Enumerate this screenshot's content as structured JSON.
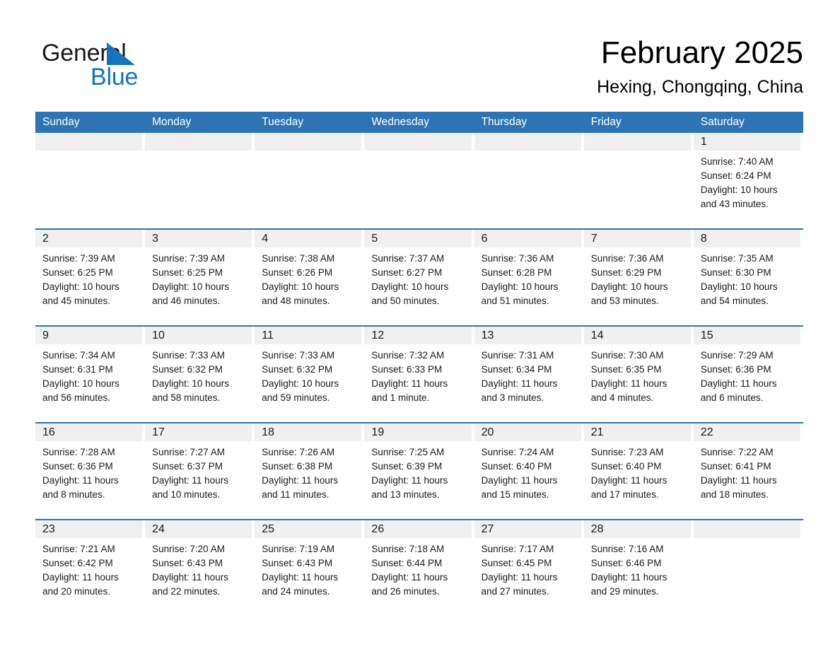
{
  "brand": {
    "logo_line1": "General",
    "logo_line2": "Blue",
    "accent_color": "#1573bd"
  },
  "header": {
    "month_title": "February 2025",
    "location": "Hexing, Chongqing, China",
    "header_bar_color": "#2e74b5",
    "date_band_color": "#f0f0f0"
  },
  "weekdays": [
    {
      "label": "Sunday"
    },
    {
      "label": "Monday"
    },
    {
      "label": "Tuesday"
    },
    {
      "label": "Wednesday"
    },
    {
      "label": "Thursday"
    },
    {
      "label": "Friday"
    },
    {
      "label": "Saturday"
    }
  ],
  "weeks": [
    {
      "days": [
        {
          "number": "",
          "empty": true,
          "sunrise": "",
          "sunset": "",
          "daylight_line1": "",
          "daylight_line2": ""
        },
        {
          "number": "",
          "empty": true,
          "sunrise": "",
          "sunset": "",
          "daylight_line1": "",
          "daylight_line2": ""
        },
        {
          "number": "",
          "empty": true,
          "sunrise": "",
          "sunset": "",
          "daylight_line1": "",
          "daylight_line2": ""
        },
        {
          "number": "",
          "empty": true,
          "sunrise": "",
          "sunset": "",
          "daylight_line1": "",
          "daylight_line2": ""
        },
        {
          "number": "",
          "empty": true,
          "sunrise": "",
          "sunset": "",
          "daylight_line1": "",
          "daylight_line2": ""
        },
        {
          "number": "",
          "empty": true,
          "sunrise": "",
          "sunset": "",
          "daylight_line1": "",
          "daylight_line2": ""
        },
        {
          "number": "1",
          "empty": false,
          "sunrise": "Sunrise: 7:40 AM",
          "sunset": "Sunset: 6:24 PM",
          "daylight_line1": "Daylight: 10 hours",
          "daylight_line2": "and 43 minutes."
        }
      ]
    },
    {
      "days": [
        {
          "number": "2",
          "empty": false,
          "sunrise": "Sunrise: 7:39 AM",
          "sunset": "Sunset: 6:25 PM",
          "daylight_line1": "Daylight: 10 hours",
          "daylight_line2": "and 45 minutes."
        },
        {
          "number": "3",
          "empty": false,
          "sunrise": "Sunrise: 7:39 AM",
          "sunset": "Sunset: 6:25 PM",
          "daylight_line1": "Daylight: 10 hours",
          "daylight_line2": "and 46 minutes."
        },
        {
          "number": "4",
          "empty": false,
          "sunrise": "Sunrise: 7:38 AM",
          "sunset": "Sunset: 6:26 PM",
          "daylight_line1": "Daylight: 10 hours",
          "daylight_line2": "and 48 minutes."
        },
        {
          "number": "5",
          "empty": false,
          "sunrise": "Sunrise: 7:37 AM",
          "sunset": "Sunset: 6:27 PM",
          "daylight_line1": "Daylight: 10 hours",
          "daylight_line2": "and 50 minutes."
        },
        {
          "number": "6",
          "empty": false,
          "sunrise": "Sunrise: 7:36 AM",
          "sunset": "Sunset: 6:28 PM",
          "daylight_line1": "Daylight: 10 hours",
          "daylight_line2": "and 51 minutes."
        },
        {
          "number": "7",
          "empty": false,
          "sunrise": "Sunrise: 7:36 AM",
          "sunset": "Sunset: 6:29 PM",
          "daylight_line1": "Daylight: 10 hours",
          "daylight_line2": "and 53 minutes."
        },
        {
          "number": "8",
          "empty": false,
          "sunrise": "Sunrise: 7:35 AM",
          "sunset": "Sunset: 6:30 PM",
          "daylight_line1": "Daylight: 10 hours",
          "daylight_line2": "and 54 minutes."
        }
      ]
    },
    {
      "days": [
        {
          "number": "9",
          "empty": false,
          "sunrise": "Sunrise: 7:34 AM",
          "sunset": "Sunset: 6:31 PM",
          "daylight_line1": "Daylight: 10 hours",
          "daylight_line2": "and 56 minutes."
        },
        {
          "number": "10",
          "empty": false,
          "sunrise": "Sunrise: 7:33 AM",
          "sunset": "Sunset: 6:32 PM",
          "daylight_line1": "Daylight: 10 hours",
          "daylight_line2": "and 58 minutes."
        },
        {
          "number": "11",
          "empty": false,
          "sunrise": "Sunrise: 7:33 AM",
          "sunset": "Sunset: 6:32 PM",
          "daylight_line1": "Daylight: 10 hours",
          "daylight_line2": "and 59 minutes."
        },
        {
          "number": "12",
          "empty": false,
          "sunrise": "Sunrise: 7:32 AM",
          "sunset": "Sunset: 6:33 PM",
          "daylight_line1": "Daylight: 11 hours",
          "daylight_line2": "and 1 minute."
        },
        {
          "number": "13",
          "empty": false,
          "sunrise": "Sunrise: 7:31 AM",
          "sunset": "Sunset: 6:34 PM",
          "daylight_line1": "Daylight: 11 hours",
          "daylight_line2": "and 3 minutes."
        },
        {
          "number": "14",
          "empty": false,
          "sunrise": "Sunrise: 7:30 AM",
          "sunset": "Sunset: 6:35 PM",
          "daylight_line1": "Daylight: 11 hours",
          "daylight_line2": "and 4 minutes."
        },
        {
          "number": "15",
          "empty": false,
          "sunrise": "Sunrise: 7:29 AM",
          "sunset": "Sunset: 6:36 PM",
          "daylight_line1": "Daylight: 11 hours",
          "daylight_line2": "and 6 minutes."
        }
      ]
    },
    {
      "days": [
        {
          "number": "16",
          "empty": false,
          "sunrise": "Sunrise: 7:28 AM",
          "sunset": "Sunset: 6:36 PM",
          "daylight_line1": "Daylight: 11 hours",
          "daylight_line2": "and 8 minutes."
        },
        {
          "number": "17",
          "empty": false,
          "sunrise": "Sunrise: 7:27 AM",
          "sunset": "Sunset: 6:37 PM",
          "daylight_line1": "Daylight: 11 hours",
          "daylight_line2": "and 10 minutes."
        },
        {
          "number": "18",
          "empty": false,
          "sunrise": "Sunrise: 7:26 AM",
          "sunset": "Sunset: 6:38 PM",
          "daylight_line1": "Daylight: 11 hours",
          "daylight_line2": "and 11 minutes."
        },
        {
          "number": "19",
          "empty": false,
          "sunrise": "Sunrise: 7:25 AM",
          "sunset": "Sunset: 6:39 PM",
          "daylight_line1": "Daylight: 11 hours",
          "daylight_line2": "and 13 minutes."
        },
        {
          "number": "20",
          "empty": false,
          "sunrise": "Sunrise: 7:24 AM",
          "sunset": "Sunset: 6:40 PM",
          "daylight_line1": "Daylight: 11 hours",
          "daylight_line2": "and 15 minutes."
        },
        {
          "number": "21",
          "empty": false,
          "sunrise": "Sunrise: 7:23 AM",
          "sunset": "Sunset: 6:40 PM",
          "daylight_line1": "Daylight: 11 hours",
          "daylight_line2": "and 17 minutes."
        },
        {
          "number": "22",
          "empty": false,
          "sunrise": "Sunrise: 7:22 AM",
          "sunset": "Sunset: 6:41 PM",
          "daylight_line1": "Daylight: 11 hours",
          "daylight_line2": "and 18 minutes."
        }
      ]
    },
    {
      "days": [
        {
          "number": "23",
          "empty": false,
          "sunrise": "Sunrise: 7:21 AM",
          "sunset": "Sunset: 6:42 PM",
          "daylight_line1": "Daylight: 11 hours",
          "daylight_line2": "and 20 minutes."
        },
        {
          "number": "24",
          "empty": false,
          "sunrise": "Sunrise: 7:20 AM",
          "sunset": "Sunset: 6:43 PM",
          "daylight_line1": "Daylight: 11 hours",
          "daylight_line2": "and 22 minutes."
        },
        {
          "number": "25",
          "empty": false,
          "sunrise": "Sunrise: 7:19 AM",
          "sunset": "Sunset: 6:43 PM",
          "daylight_line1": "Daylight: 11 hours",
          "daylight_line2": "and 24 minutes."
        },
        {
          "number": "26",
          "empty": false,
          "sunrise": "Sunrise: 7:18 AM",
          "sunset": "Sunset: 6:44 PM",
          "daylight_line1": "Daylight: 11 hours",
          "daylight_line2": "and 26 minutes."
        },
        {
          "number": "27",
          "empty": false,
          "sunrise": "Sunrise: 7:17 AM",
          "sunset": "Sunset: 6:45 PM",
          "daylight_line1": "Daylight: 11 hours",
          "daylight_line2": "and 27 minutes."
        },
        {
          "number": "28",
          "empty": false,
          "sunrise": "Sunrise: 7:16 AM",
          "sunset": "Sunset: 6:46 PM",
          "daylight_line1": "Daylight: 11 hours",
          "daylight_line2": "and 29 minutes."
        },
        {
          "number": "",
          "empty": true,
          "sunrise": "",
          "sunset": "",
          "daylight_line1": "",
          "daylight_line2": ""
        }
      ]
    }
  ]
}
